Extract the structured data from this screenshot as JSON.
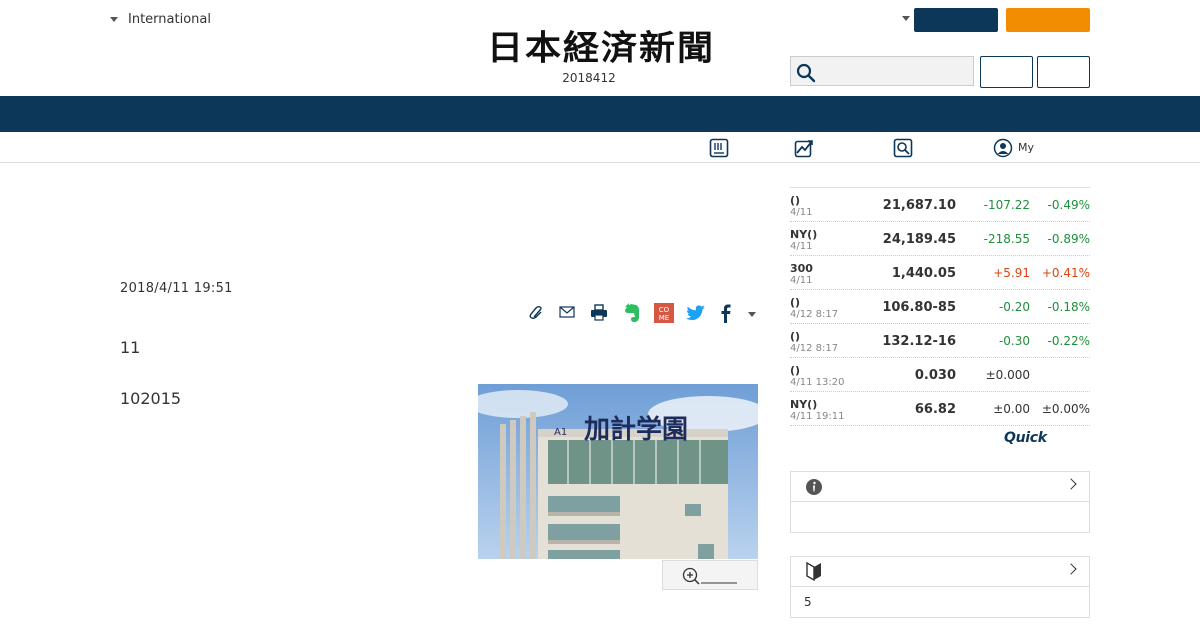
{
  "header": {
    "region_label": "International",
    "logo_text": "日本経済新聞",
    "date_line": "2018412",
    "subnav_my_label": "My"
  },
  "article": {
    "date": "2018/4/11 19:51",
    "paragraph1": "11",
    "paragraph2": "102015",
    "photo_sign_text": "加計学園",
    "photo_sign_small": "A1"
  },
  "colors": {
    "navy": "#0d3759",
    "orange": "#f28c00",
    "negative": "#1e8f3a",
    "positive": "#d9450f"
  },
  "market": {
    "rows": [
      {
        "name": "()",
        "date": "4/11",
        "value": "21,687.10",
        "change": "-107.22",
        "pct": "-0.49%",
        "dir": "neg"
      },
      {
        "name": "NY()",
        "date": "4/11",
        "value": "24,189.45",
        "change": "-218.55",
        "pct": "-0.89%",
        "dir": "neg"
      },
      {
        "name": "300",
        "date": "4/11",
        "value": "1,440.05",
        "change": "+5.91",
        "pct": "+0.41%",
        "dir": "pos"
      },
      {
        "name": "()",
        "date": "4/12 8:17",
        "value": "106.80-85",
        "change": "-0.20",
        "pct": "-0.18%",
        "dir": "neg"
      },
      {
        "name": "()",
        "date": "4/12 8:17",
        "value": "132.12-16",
        "change": "-0.30",
        "pct": "-0.22%",
        "dir": "neg"
      },
      {
        "name": "()",
        "date": "4/11 13:20",
        "value": "0.030",
        "change": "±0.000",
        "pct": "",
        "dir": "flat"
      },
      {
        "name": "NY()",
        "date": "4/11 19:11",
        "value": "66.82",
        "change": "±0.00",
        "pct": "±0.00%",
        "dir": "flat"
      }
    ],
    "source_logo": "Quick"
  },
  "boxes": {
    "info_body": "",
    "beginner_body": "5"
  }
}
